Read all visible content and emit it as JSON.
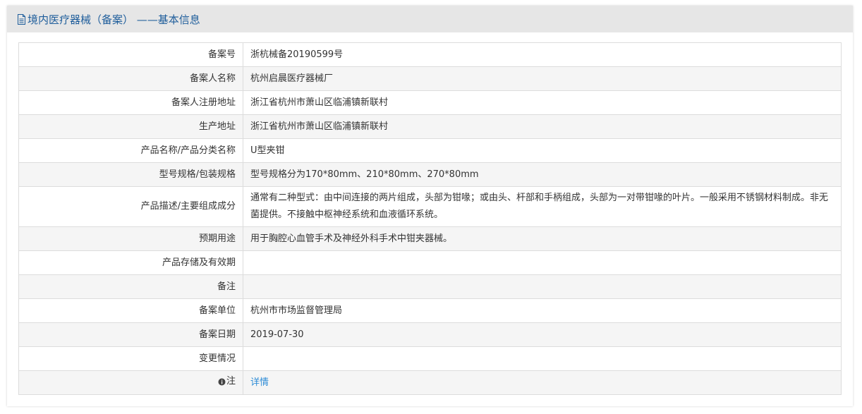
{
  "header": {
    "title": "境内医疗器械（备案） ——基本信息",
    "icon": "document-icon",
    "title_color": "#1e5d9b"
  },
  "rows": [
    {
      "label": "备案号",
      "value": "浙杭械备20190599号"
    },
    {
      "label": "备案人名称",
      "value": "杭州启晨医疗器械厂"
    },
    {
      "label": "备案人注册地址",
      "value": "浙江省杭州市萧山区临浦镇新联村"
    },
    {
      "label": "生产地址",
      "value": "浙江省杭州市萧山区临浦镇新联村"
    },
    {
      "label": "产品名称/产品分类名称",
      "value": "U型夹钳"
    },
    {
      "label": "型号规格/包装规格",
      "value": "型号规格分为170*80mm、210*80mm、270*80mm"
    },
    {
      "label": "产品描述/主要组成成分",
      "value": "通常有二种型式：由中间连接的两片组成，头部为钳喙；或由头、杆部和手柄组成，头部为一对带钳喙的叶片。一般采用不锈钢材料制成。非无菌提供。不接触中枢神经系统和血液循环系统。"
    },
    {
      "label": "预期用途",
      "value": "用于胸腔心血管手术及神经外科手术中钳夹器械。"
    },
    {
      "label": "产品存储及有效期",
      "value": ""
    },
    {
      "label": "备注",
      "value": ""
    },
    {
      "label": "备案单位",
      "value": "杭州市市场监督管理局"
    },
    {
      "label": "备案日期",
      "value": "2019-07-30"
    },
    {
      "label": "变更情况",
      "value": ""
    }
  ],
  "note_row": {
    "label": "注",
    "icon": "info-icon",
    "link_text": "详情",
    "link_color": "#2d8cd6"
  }
}
